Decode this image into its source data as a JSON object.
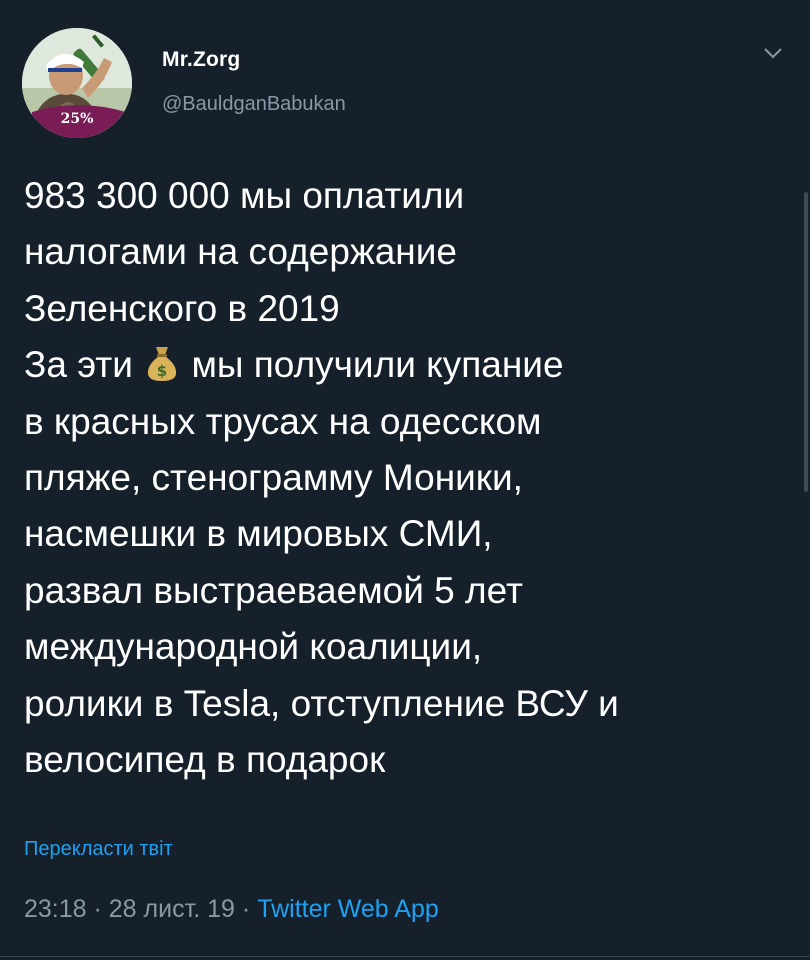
{
  "user": {
    "display_name": "Mr.Zorg",
    "handle": "@BauldganBabukan",
    "avatar_badge": "25%"
  },
  "tweet": {
    "lines_part1": [
      "983 300 000 мы оплатили",
      "налогами на содержание",
      "Зеленского в 2019"
    ],
    "line4_before": "За эти",
    "line4_emoji": "money-bag-icon",
    "line4_after": "мы получили купание",
    "lines_part2": [
      "в красных трусах на одесском",
      "пляже, стенограмму Моники,",
      "насмешки в мировых СМИ,",
      "развал выстраеваемой 5 лет",
      "международной коалиции,",
      "ролики в Tesla, отступление ВСУ и",
      "велосипед в подарок"
    ]
  },
  "translate_link": "Перекласти твіт",
  "meta": {
    "time": "23:18",
    "date": "28 лист. 19",
    "separator": " · ",
    "source": "Twitter Web App"
  },
  "colors": {
    "background": "#15202b",
    "text": "#ffffff",
    "secondary": "#8899a6",
    "link": "#1da1f2",
    "badge": "#7a1c55"
  }
}
